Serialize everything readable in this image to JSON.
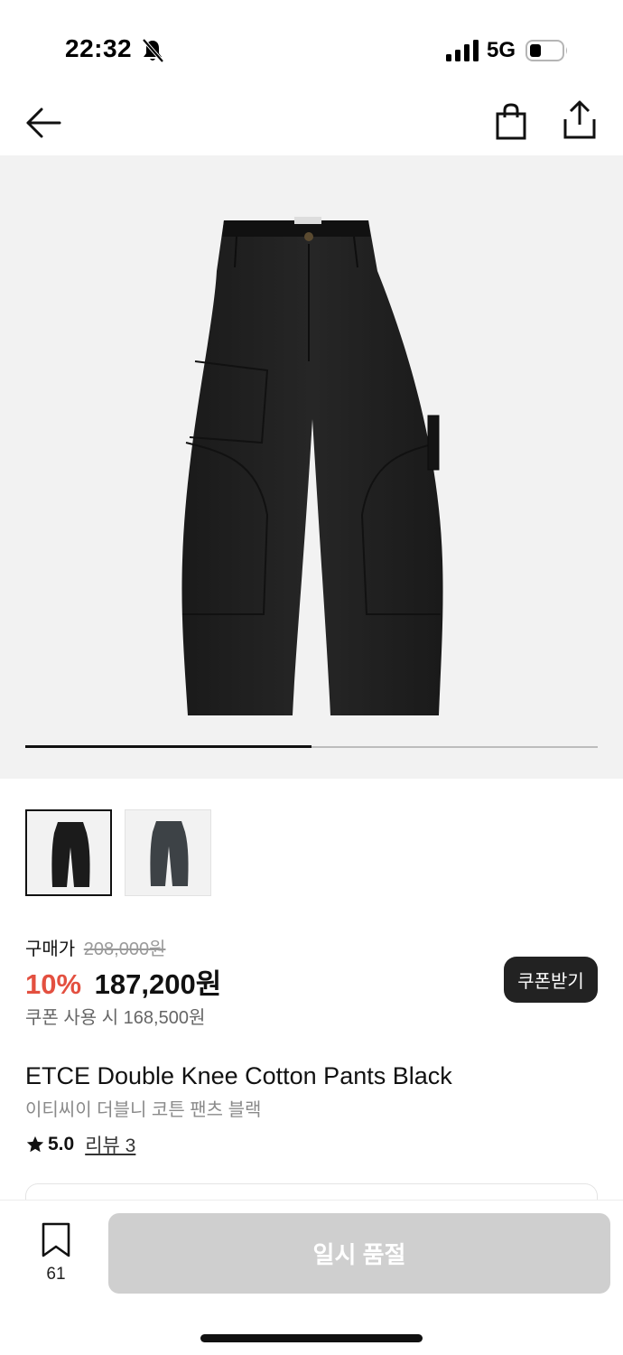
{
  "status_bar": {
    "time": "22:32",
    "network": "5G",
    "icons": [
      "bell-slash-icon",
      "signal-icon",
      "battery-icon"
    ]
  },
  "nav": {
    "icons": [
      "back-arrow-icon",
      "shopping-bag-icon",
      "share-icon"
    ]
  },
  "gallery": {
    "images": [
      "black-pants",
      "charcoal-pants"
    ],
    "active_index": 0,
    "progress_fraction": 0.5
  },
  "price": {
    "label": "구매가",
    "original": "208,000원",
    "discount_rate": "10%",
    "sale": "187,200원",
    "coupon_text": "쿠폰 사용 시 168,500원",
    "coupon_button": "쿠폰받기"
  },
  "product": {
    "title": "ETCE Double Knee Cotton Pants Black",
    "subtitle": "이티씨이 더블니 코튼 팬츠 블랙",
    "rating": "5.0",
    "review_link": "리뷰 3"
  },
  "bottom_bar": {
    "bookmark_count": "61",
    "action_label": "일시 품절"
  },
  "colors": {
    "accent_red": "#e35040",
    "dark_button": "#222222",
    "disabled_button": "#cfcfcf",
    "hero_bg": "#f2f2f2"
  }
}
